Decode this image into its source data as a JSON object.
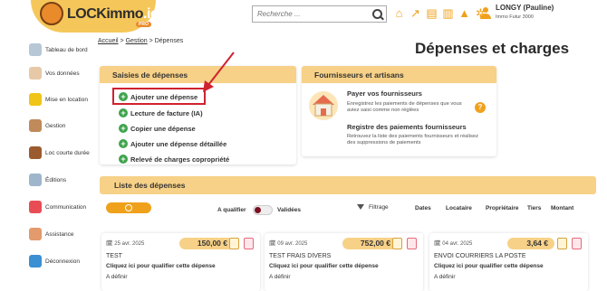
{
  "header": {
    "logo_text": "LOCKimmo",
    "logo_suffix": ".io",
    "logo_badge": "PRO",
    "search_placeholder": "Recherche ...",
    "user_name": "LONGY (Pauline)",
    "user_plan": "Immo Futur 3000",
    "icons": [
      "home-icon",
      "external-link-icon",
      "document-icon",
      "bank-icon",
      "gear-icon",
      "user-icon"
    ]
  },
  "sidebar": {
    "items": [
      {
        "label": "Tableau de bord",
        "icon": "dashboard-icon",
        "color": "#b7c7d6"
      },
      {
        "label": "Vos données",
        "icon": "person-icon",
        "color": "#e7c9a8"
      },
      {
        "label": "Mise en location",
        "icon": "key-icon",
        "color": "#f0c419"
      },
      {
        "label": "Gestion",
        "icon": "calculator-icon",
        "color": "#c08a5a"
      },
      {
        "label": "Loc courte durée",
        "icon": "suitcase-icon",
        "color": "#9c5b2e"
      },
      {
        "label": "Éditions",
        "icon": "edit-icon",
        "color": "#9fb5cc"
      },
      {
        "label": "Communication",
        "icon": "chat-icon",
        "color": "#e84c55"
      },
      {
        "label": "Assistance",
        "icon": "support-icon",
        "color": "#e39a6c"
      },
      {
        "label": "Déconnexion",
        "icon": "logout-icon",
        "color": "#3b8fd3"
      }
    ]
  },
  "breadcrumb": {
    "home": "Accueil",
    "sep1": ">",
    "section": "Gestion",
    "sep2": ">",
    "current": "Dépenses"
  },
  "page_title": "Dépenses et charges",
  "saisies": {
    "title": "Saisies de dépenses",
    "actions": [
      "Ajouter une dépense",
      "Lecture de facture (IA)",
      "Copier une dépense",
      "Ajouter une dépense détaillée",
      "Relevé de charges copropriété"
    ]
  },
  "fournisseurs": {
    "title": "Fournisseurs et artisans",
    "pay_title": "Payer vos fournisseurs",
    "pay_desc": "Enregistrez les paiements de dépenses que vous aviez saisi comme non réglées",
    "reg_title": "Registre des paiements fournisseurs",
    "reg_desc": "Retrouvez la liste des paiements fournisseurs et réalisez des suppressions de paiements",
    "help": "?"
  },
  "list": {
    "title": "Liste des dépenses",
    "a_qualifier": "A qualifier",
    "validees": "Validées",
    "filtrage": "Filtrage",
    "columns": [
      "Dates",
      "Locataire",
      "Propriétaire",
      "Tiers",
      "Montant"
    ]
  },
  "expenses": [
    {
      "date": "25 avr. 2025",
      "amount": "150,00 €",
      "title": "TEST",
      "cta": "Cliquez ici pour qualifier cette dépense",
      "status": "A définir"
    },
    {
      "date": "09 avr. 2025",
      "amount": "752,00 €",
      "title": "TEST FRAIS DIVERS",
      "cta": "Cliquez ici pour qualifier cette dépense",
      "status": "A définir"
    },
    {
      "date": "04 avr. 2025",
      "amount": "3,64 €",
      "title": "ENVOI COURRIERS LA POSTE",
      "cta": "Cliquez ici pour qualifier cette dépense",
      "status": "A définir"
    }
  ]
}
